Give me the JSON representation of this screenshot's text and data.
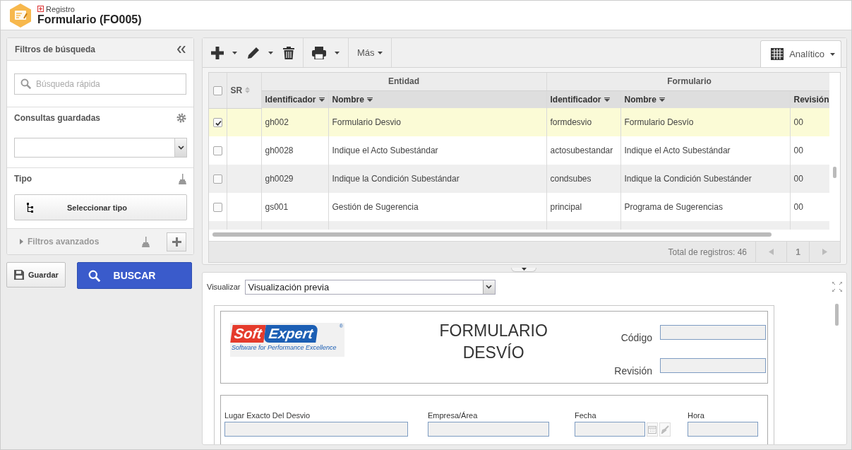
{
  "header": {
    "breadcrumb": "Registro",
    "title": "Formulario (FO005)"
  },
  "filters": {
    "title": "Filtros de búsqueda",
    "search": {
      "placeholder": "Búsqueda rápida"
    },
    "saved_queries": {
      "label": "Consultas guardadas"
    },
    "type": {
      "label": "Tipo",
      "button": "Seleccionar tipo"
    },
    "advanced": {
      "label": "Filtros avanzados",
      "expanded": false
    }
  },
  "actions": {
    "save": "Guardar",
    "search": "BUSCAR"
  },
  "toolbar": {
    "more": "Más",
    "view": "Analítico"
  },
  "table": {
    "select_all": false,
    "sr_column": "SR",
    "groups": [
      {
        "label": "Entidad",
        "columns": [
          "Identificador",
          "Nombre"
        ]
      },
      {
        "label": "Formulario",
        "columns": [
          "Identificador",
          "Nombre",
          "Revisión"
        ]
      }
    ],
    "rows": [
      {
        "selected": true,
        "cells": [
          "gh002",
          "Formulario Desvio",
          "formdesvio",
          "Formulario Desvío",
          "00"
        ]
      },
      {
        "selected": false,
        "cells": [
          "gh0028",
          "Indique el Acto Subestándar",
          "actosubestandar",
          "Indique el Acto Subestándar",
          "00"
        ]
      },
      {
        "selected": false,
        "cells": [
          "gh0029",
          "Indique la Condición Subestándar",
          "condsubes",
          "Indique la Condición Subestánder",
          "00"
        ]
      },
      {
        "selected": false,
        "cells": [
          "gs001",
          "Gestión de Sugerencia",
          "principal",
          "Programa de Sugerencias",
          "00"
        ]
      }
    ],
    "total": "Total de registros: 46",
    "page": "1"
  },
  "preview": {
    "label": "Visualizar",
    "value": "Visualización previa",
    "document": {
      "logo": {
        "brand_left": "Soft",
        "brand_right": "Expert",
        "mark": "®",
        "tagline": "Software for Performance Excellence"
      },
      "title": "FORMULARIO DESVÍO",
      "header_fields": [
        "Código",
        "Revisión"
      ],
      "fields": [
        {
          "label": "Lugar Exacto Del Desvio",
          "kind": "text"
        },
        {
          "label": "Empresa/Área",
          "kind": "text"
        },
        {
          "label": "Fecha",
          "kind": "date"
        },
        {
          "label": "Hora",
          "kind": "text"
        }
      ]
    }
  }
}
